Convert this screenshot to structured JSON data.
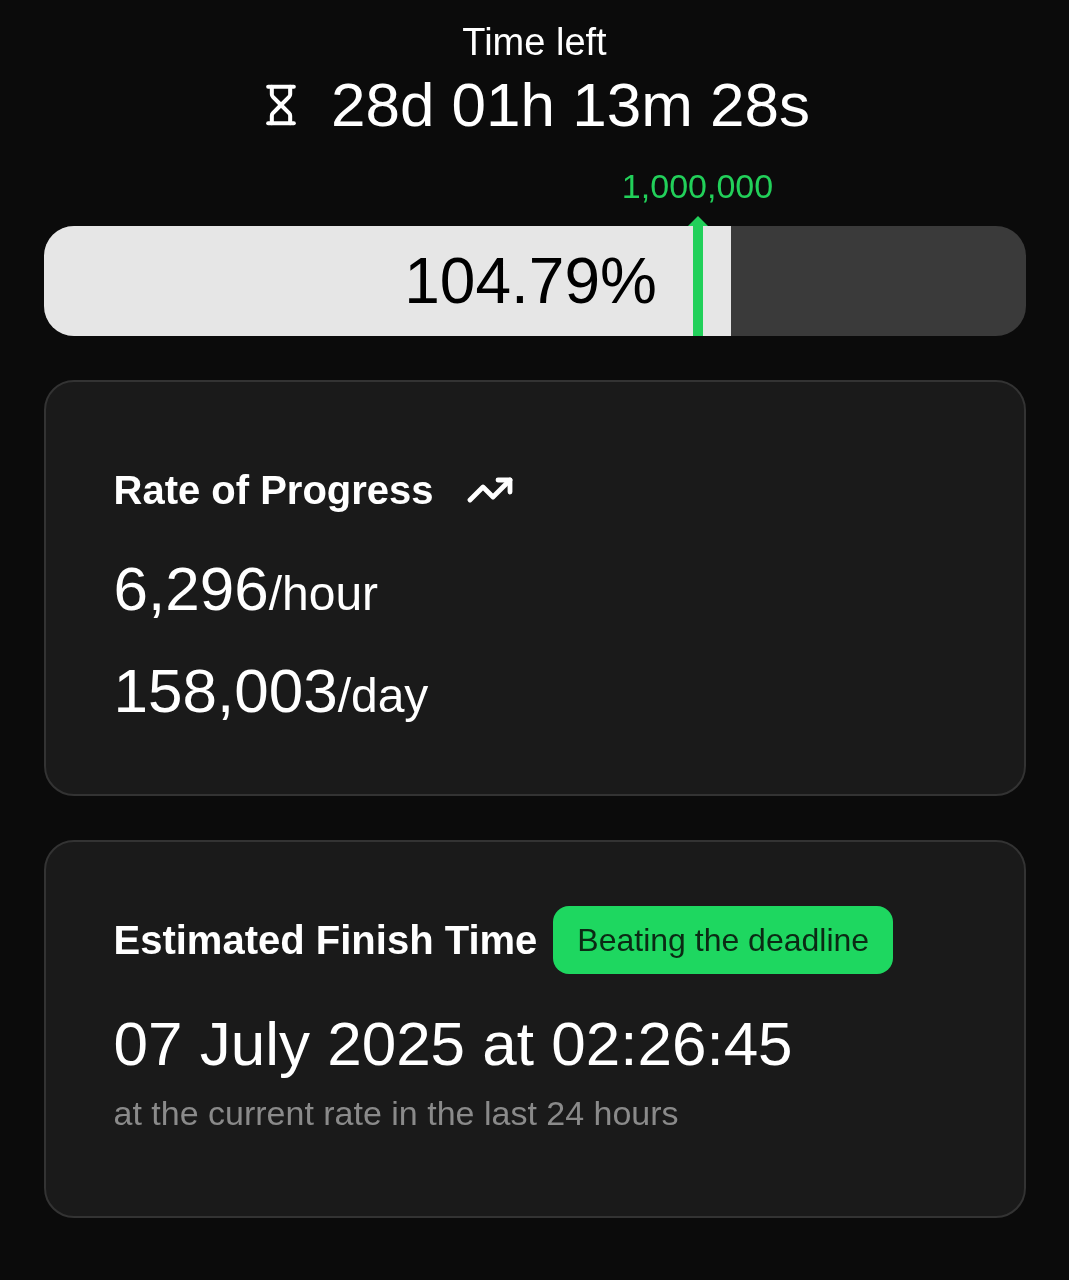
{
  "countdown": {
    "title": "Time left",
    "value": "28d 01h 13m 28s"
  },
  "progress": {
    "level": 0.7,
    "percent": "104.79%",
    "target": {
      "label": "1,000,000",
      "level": 0.666
    }
  },
  "rate_card": {
    "title": "Rate of Progress",
    "rates": [
      {
        "value": "6,296",
        "unit": "/hour"
      },
      {
        "value": "158,003",
        "unit": "/day"
      }
    ]
  },
  "finish_card": {
    "title": "Estimated Finish Time",
    "badge": {
      "label": "Beating the deadline",
      "color": "#1ed760"
    },
    "date": "07 July 2025 at 02:26:45",
    "note": "at the current rate in the last 24 hours"
  }
}
